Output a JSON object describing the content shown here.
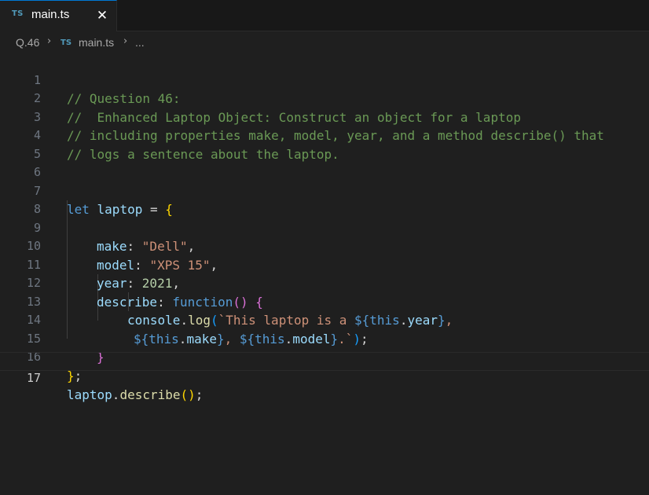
{
  "tab": {
    "icon_text": "TS",
    "label": "main.ts",
    "close_glyph": "✕"
  },
  "breadcrumb": {
    "folder": "Q.46",
    "file_icon_text": "TS",
    "file": "main.ts",
    "more": "...",
    "separator": "›"
  },
  "editor": {
    "current_line": 17,
    "line_numbers": [
      "1",
      "2",
      "3",
      "4",
      "5",
      "6",
      "7",
      "8",
      "9",
      "10",
      "11",
      "12",
      "13",
      "14",
      "15",
      "16",
      "17"
    ],
    "code": {
      "l1": "// Question 46:",
      "l2": "//  Enhanced Laptop Object: Construct an object for a laptop",
      "l3": "// including properties make, model, year, and a method describe() that",
      "l4": "// logs a sentence about the laptop.",
      "l7": {
        "kw": "let",
        "name": " laptop",
        "op": " = ",
        "brace": "{"
      },
      "l9": {
        "key": "make",
        "colon": ": ",
        "val": "\"Dell\"",
        "comma": ","
      },
      "l10": {
        "key": "model",
        "colon": ": ",
        "val": "\"XPS 15\"",
        "comma": ","
      },
      "l11": {
        "key": "year",
        "colon": ": ",
        "val": "2021",
        "comma": ","
      },
      "l12": {
        "key": "describe",
        "colon": ": ",
        "kw": "function",
        "paren": "()",
        "sp": " ",
        "brace": "{"
      },
      "l13": {
        "obj": "console",
        "dot": ".",
        "fn": "log",
        "paren": "(",
        "str": "`This laptop is a ",
        "tpl_open": "${",
        "this": "this",
        "dot2": ".",
        "prop": "year",
        "tpl_close": "}",
        "str2": ","
      },
      "l14": {
        "tpl1_open": "${",
        "this1": "this",
        "dot1": ".",
        "prop1": "make",
        "tpl1_close": "}",
        "str_mid": ", ",
        "tpl2_open": "${",
        "this2": "this",
        "dot2": ".",
        "prop2": "model",
        "tpl2_close": "}",
        "str_end": ".`",
        "paren": ")",
        "semi": ";"
      },
      "l15": {
        "brace": "}"
      },
      "l16": {
        "brace": "}",
        "semi": ";"
      },
      "l17": {
        "obj": "laptop",
        "dot": ".",
        "fn": "describe",
        "paren": "()",
        "semi": ";"
      }
    }
  }
}
